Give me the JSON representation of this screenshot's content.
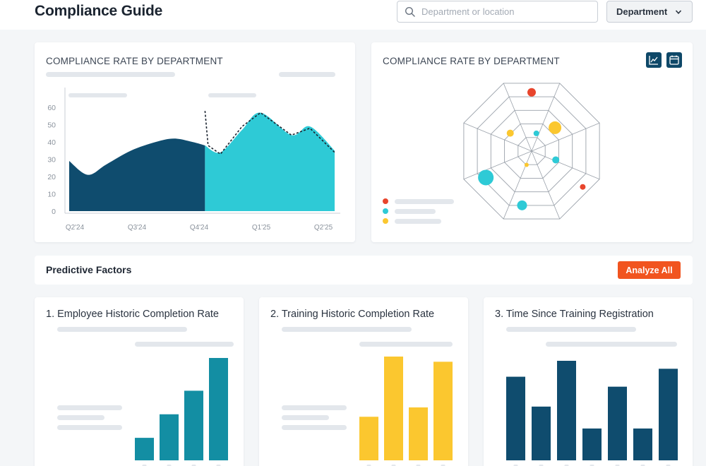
{
  "header": {
    "title": "Compliance Guide",
    "search_placeholder": "Department or location",
    "department_button": "Department"
  },
  "area_card": {
    "title": "COMPLIANCE RATE BY DEPARTMENT"
  },
  "radar_card": {
    "title": "COMPLIANCE RATE BY DEPARTMENT",
    "icons": [
      "line-chart-icon",
      "calendar-icon"
    ]
  },
  "predictive": {
    "title": "Predictive Factors",
    "analyze_button": "Analyze All"
  },
  "factors": [
    {
      "title": "1. Employee Historic Completion Rate"
    },
    {
      "title": "2. Training Historic Completion Rate"
    },
    {
      "title": "3. Time Since Training Registration"
    }
  ],
  "colors": {
    "navy": "#0f4c6e",
    "cyan": "#2ecad6",
    "teal": "#138ea3",
    "yellow": "#fbc72f",
    "red": "#e8452c",
    "orange_button": "#f1541f"
  },
  "chart_data": [
    {
      "type": "area",
      "title": "COMPLIANCE RATE BY DEPARTMENT",
      "x_ticks": [
        "Q2'24",
        "Q3'24",
        "Q4'24",
        "Q1'25",
        "Q2'25"
      ],
      "y_ticks": [
        0,
        10,
        20,
        30,
        40,
        50,
        60
      ],
      "ylim": [
        0,
        65
      ],
      "xlim": [
        0,
        4.3
      ],
      "series": [
        {
          "color": "#0f4c6e",
          "points": [
            [
              0.0,
              29
            ],
            [
              0.3,
              21
            ],
            [
              0.6,
              27
            ],
            [
              1.0,
              35
            ],
            [
              1.4,
              40
            ],
            [
              1.7,
              42
            ],
            [
              2.0,
              40
            ],
            [
              2.2,
              38
            ]
          ]
        },
        {
          "color": "#2ecad6",
          "points": [
            [
              2.2,
              38
            ],
            [
              2.45,
              34
            ],
            [
              2.8,
              47
            ],
            [
              3.1,
              57
            ],
            [
              3.6,
              44
            ],
            [
              3.9,
              49
            ],
            [
              4.3,
              35
            ]
          ]
        }
      ],
      "forecast_line": [
        [
          2.2,
          58
        ],
        [
          2.25,
          38
        ],
        [
          2.45,
          33
        ],
        [
          2.8,
          49
        ],
        [
          3.1,
          57
        ],
        [
          3.6,
          44
        ],
        [
          3.9,
          48
        ],
        [
          4.3,
          34
        ]
      ],
      "grid": false
    },
    {
      "type": "scatter",
      "subtype": "radar",
      "rings": 5,
      "spokes": 8,
      "points": [
        {
          "angle": 45,
          "radius": 0.45,
          "size": 9,
          "color": "#fbc72f"
        },
        {
          "angle": 110,
          "radius": 0.35,
          "size": 5,
          "color": "#2ecad6"
        },
        {
          "angle": 125,
          "radius": 0.85,
          "size": 4,
          "color": "#e8452c"
        },
        {
          "angle": 190,
          "radius": 0.75,
          "size": 7,
          "color": "#2ecad6"
        },
        {
          "angle": 200,
          "radius": 0.2,
          "size": 3,
          "color": "#fbc72f"
        },
        {
          "angle": 240,
          "radius": 0.72,
          "size": 11,
          "color": "#2ecad6"
        },
        {
          "angle": 310,
          "radius": 0.38,
          "size": 5,
          "color": "#fbc72f"
        },
        {
          "angle": 15,
          "radius": 0.25,
          "size": 4,
          "color": "#2ecad6"
        },
        {
          "angle": 0,
          "radius": 0.8,
          "size": 6,
          "color": "#e8452c"
        }
      ],
      "legend": [
        "#e8452c",
        "#2ecad6",
        "#fbc72f"
      ],
      "legend_placement": "bottom-left"
    },
    {
      "type": "bar",
      "color": "#138ea3",
      "values": [
        22,
        45,
        68,
        100
      ],
      "ylim": [
        0,
        100
      ]
    },
    {
      "type": "bar",
      "color": "#fbc72f",
      "values": [
        42,
        100,
        51,
        95
      ],
      "ylim": [
        0,
        100
      ]
    },
    {
      "type": "bar",
      "color": "#0f4c6e",
      "values": [
        84,
        54,
        100,
        32,
        74,
        32,
        92
      ],
      "ylim": [
        0,
        100
      ]
    }
  ]
}
